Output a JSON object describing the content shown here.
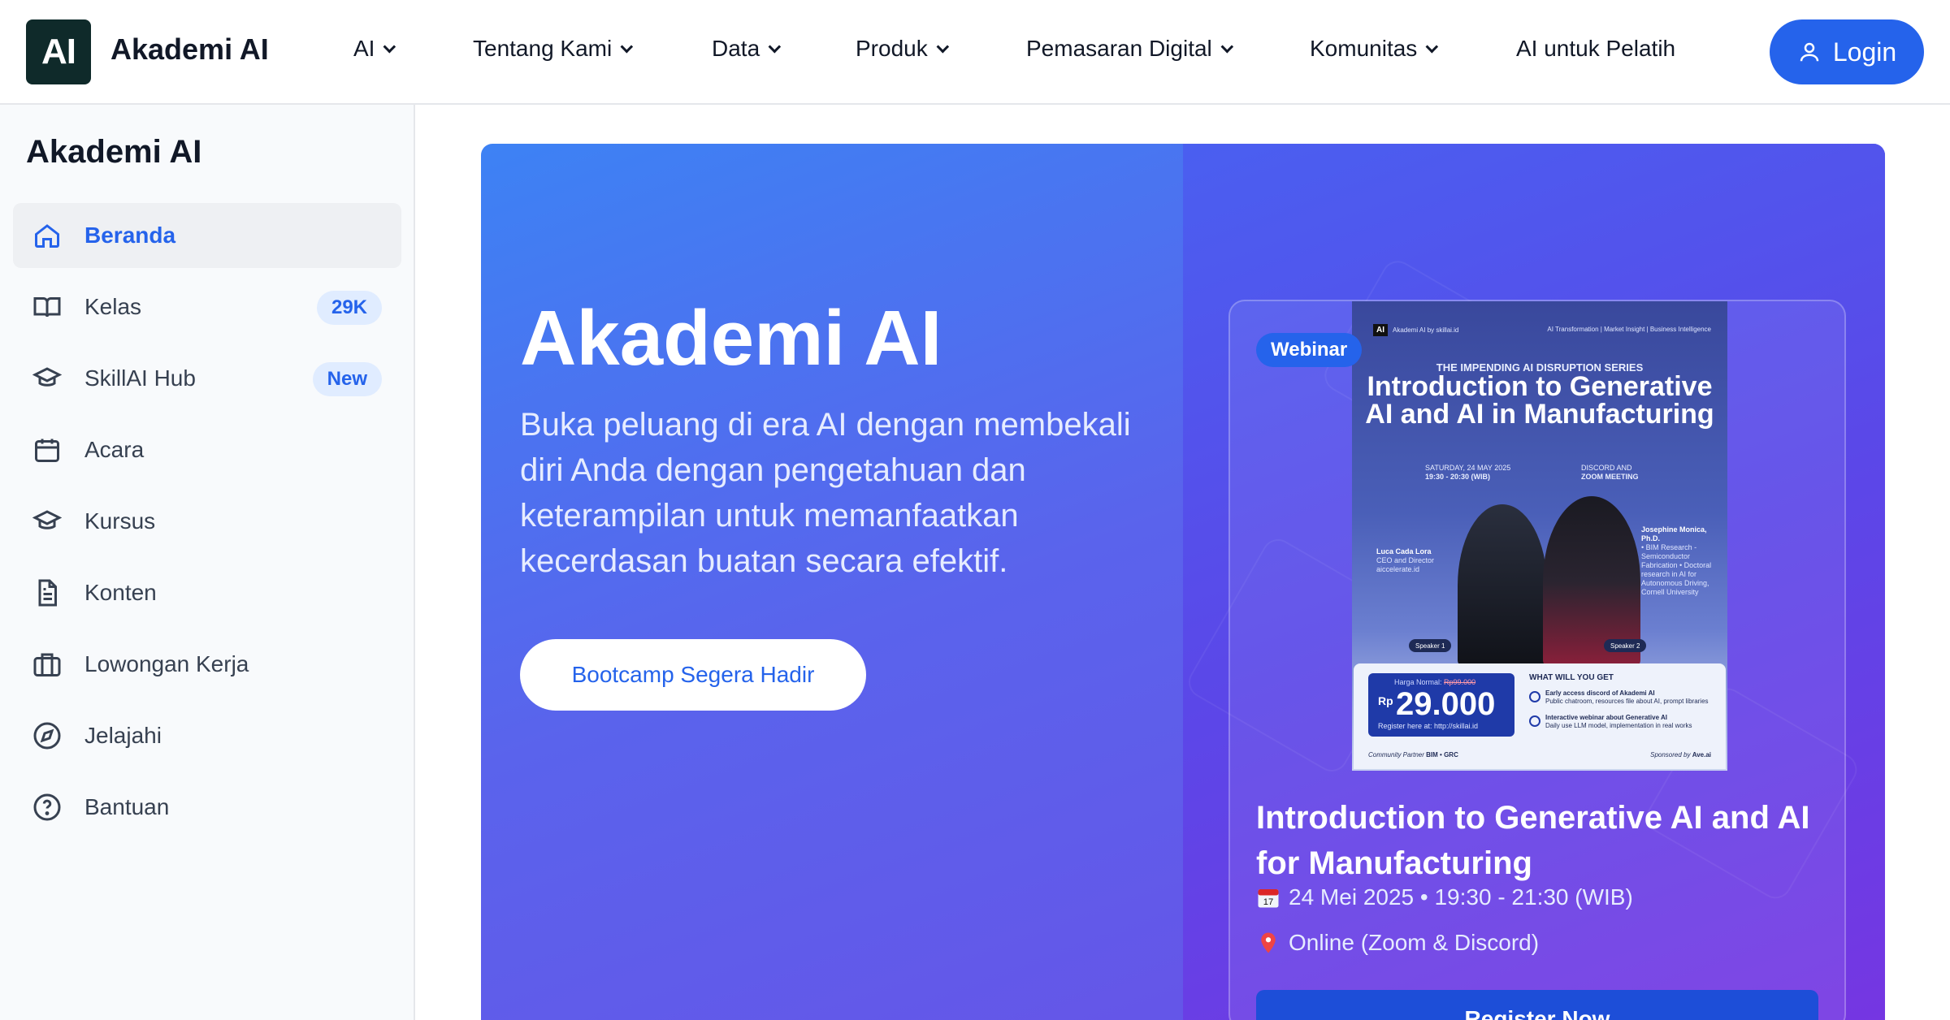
{
  "header": {
    "logo_text": "AI",
    "brand": "Akademi AI",
    "nav": [
      {
        "label": "AI",
        "has_dropdown": true
      },
      {
        "label": "Tentang Kami",
        "has_dropdown": true
      },
      {
        "label": "Data",
        "has_dropdown": true
      },
      {
        "label": "Produk",
        "has_dropdown": true
      },
      {
        "label": "Pemasaran Digital",
        "has_dropdown": true
      },
      {
        "label": "Komunitas",
        "has_dropdown": true
      },
      {
        "label": "AI untuk Pelatih",
        "has_dropdown": false
      }
    ],
    "login_label": "Login"
  },
  "sidebar": {
    "title": "Akademi AI",
    "items": [
      {
        "label": "Beranda",
        "icon": "home-icon",
        "active": true
      },
      {
        "label": "Kelas",
        "icon": "book-icon",
        "badge": "29K"
      },
      {
        "label": "SkillAI Hub",
        "icon": "graduation-cap-icon",
        "badge": "New"
      },
      {
        "label": "Acara",
        "icon": "calendar-icon"
      },
      {
        "label": "Kursus",
        "icon": "graduation-cap-icon"
      },
      {
        "label": "Konten",
        "icon": "document-icon"
      },
      {
        "label": "Lowongan Kerja",
        "icon": "briefcase-icon"
      },
      {
        "label": "Jelajahi",
        "icon": "compass-icon"
      },
      {
        "label": "Bantuan",
        "icon": "help-circle-icon"
      }
    ]
  },
  "hero": {
    "title": "Akademi AI",
    "subtitle": "Buka peluang di era AI dengan membekali diri Anda dengan pengetahuan dan keterampilan untuk memanfaatkan kecerdasan buatan secara efektif.",
    "button_label": "Bootcamp Segera Hadir"
  },
  "event": {
    "badge": "Webinar",
    "poster": {
      "org": "Akademi AI by skillai.id",
      "tagline": "AI Transformation | Market Insight | Business Intelligence",
      "series": "THE IMPENDING AI DISRUPTION SERIES",
      "title": "Introduction to Generative AI and AI in Manufacturing",
      "date_line1": "SATURDAY, 24 MAY 2025",
      "date_line2": "19:30 - 20:30 (WIB)",
      "venue_line1": "DISCORD AND",
      "venue_line2": "ZOOM MEETING",
      "speaker1_name": "Luca Cada Lora",
      "speaker1_role": "CEO and Director aiccelerate.id",
      "speaker1_tag": "Speaker 1",
      "speaker2_name": "Josephine Monica, Ph.D.",
      "speaker2_role": "• BIM Research - Semiconductor Fabrication • Doctoral research in AI for Autonomous Driving, Cornell University",
      "speaker2_tag": "Speaker 2",
      "price_normal_label": "Harga Normal:",
      "price_normal": "Rp99.000",
      "price_currency": "Rp",
      "price": "29.000",
      "register_text": "Register here at: http://skillai.id",
      "get_title": "WHAT WILL YOU GET",
      "get1_title": "Early access discord of Akademi AI",
      "get1_desc": "Public chatroom, resources file about AI, prompt libraries",
      "get2_title": "Interactive webinar about Generative AI",
      "get2_desc": "Daily use LLM model, implementation in real works",
      "community_label": "Community Partner",
      "partners": "BIM  •  GRC",
      "sponsor_label": "Sponsored by",
      "sponsor": "Ave.ai"
    },
    "title": "Introduction to Generative AI and AI for Manufacturing",
    "date": "24 Mei 2025 • 19:30 - 21:30 (WIB)",
    "location": "Online (Zoom & Discord)",
    "register_label": "Register Now"
  },
  "colors": {
    "primary": "#2563eb",
    "hero_start": "#3d82f4",
    "hero_end": "#7536e2"
  }
}
